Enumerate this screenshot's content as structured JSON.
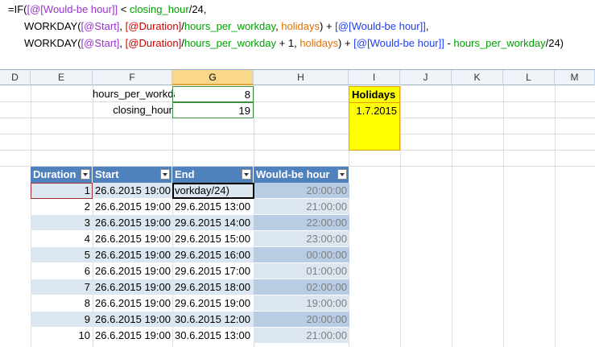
{
  "formula": {
    "line1": [
      [
        "f-blk",
        "=IF("
      ],
      [
        "f-pur",
        "[@[Would-be hour]]"
      ],
      [
        "f-blk",
        " < "
      ],
      [
        "f-grn",
        "closing_hour"
      ],
      [
        "f-blk",
        "/24,"
      ]
    ],
    "line2": [
      [
        "f-blk",
        "WORKDAY("
      ],
      [
        "f-pur",
        "[@Start]"
      ],
      [
        "f-blk",
        ", "
      ],
      [
        "f-red",
        "[@Duration]"
      ],
      [
        "f-blk",
        "/"
      ],
      [
        "f-grn",
        "hours_per_workday"
      ],
      [
        "f-blk",
        ", "
      ],
      [
        "f-ora",
        "holidays"
      ],
      [
        "f-blk",
        ") + "
      ],
      [
        "f-blu",
        "[@[Would-be hour]]"
      ],
      [
        "f-blk",
        ","
      ]
    ],
    "line3": [
      [
        "f-blk",
        "WORKDAY("
      ],
      [
        "f-pur",
        "[@Start]"
      ],
      [
        "f-blk",
        ", "
      ],
      [
        "f-red",
        "[@Duration]"
      ],
      [
        "f-blk",
        "/"
      ],
      [
        "f-grn",
        "hours_per_workday"
      ],
      [
        "f-blk",
        " + 1, "
      ],
      [
        "f-ora",
        "holidays"
      ],
      [
        "f-blk",
        ") + "
      ],
      [
        "f-blu",
        "[@[Would-be hour]]"
      ],
      [
        "f-blk",
        " - "
      ],
      [
        "f-grn",
        "hours_per_workday"
      ],
      [
        "f-blk",
        "/24)"
      ]
    ]
  },
  "columns": [
    "D",
    "E",
    "F",
    "G",
    "H",
    "I",
    "J",
    "K",
    "L",
    "M"
  ],
  "named": {
    "hours_label": "hours_per_workday",
    "hours_value": "8",
    "closing_label": "closing_hour",
    "closing_value": "19"
  },
  "holidays": {
    "header": "Holidays",
    "value": "1.7.2015"
  },
  "table": {
    "headers": [
      "Duration",
      "Start",
      "End",
      "Would-be hour"
    ],
    "rows": [
      [
        "1",
        "26.6.2015  19:00",
        "vorkday/24)",
        "20:00:00"
      ],
      [
        "2",
        "26.6.2015  19:00",
        "29.6.2015 13:00",
        "21:00:00"
      ],
      [
        "3",
        "26.6.2015  19:00",
        "29.6.2015 14:00",
        "22:00:00"
      ],
      [
        "4",
        "26.6.2015  19:00",
        "29.6.2015 15:00",
        "23:00:00"
      ],
      [
        "5",
        "26.6.2015  19:00",
        "29.6.2015 16:00",
        "00:00:00"
      ],
      [
        "6",
        "26.6.2015  19:00",
        "29.6.2015 17:00",
        "01:00:00"
      ],
      [
        "7",
        "26.6.2015  19:00",
        "29.6.2015 18:00",
        "02:00:00"
      ],
      [
        "8",
        "26.6.2015  19:00",
        "29.6.2015 19:00",
        "19:00:00"
      ],
      [
        "9",
        "26.6.2015  19:00",
        "30.6.2015 12:00",
        "20:00:00"
      ],
      [
        "10",
        "26.6.2015  19:00",
        "30.6.2015 13:00",
        "21:00:00"
      ]
    ]
  },
  "colors": {
    "table_header": "#4f81bd",
    "band": "#dce6f1",
    "holidays_fill": "#ffff00",
    "selected_col": "#f9d88b"
  }
}
